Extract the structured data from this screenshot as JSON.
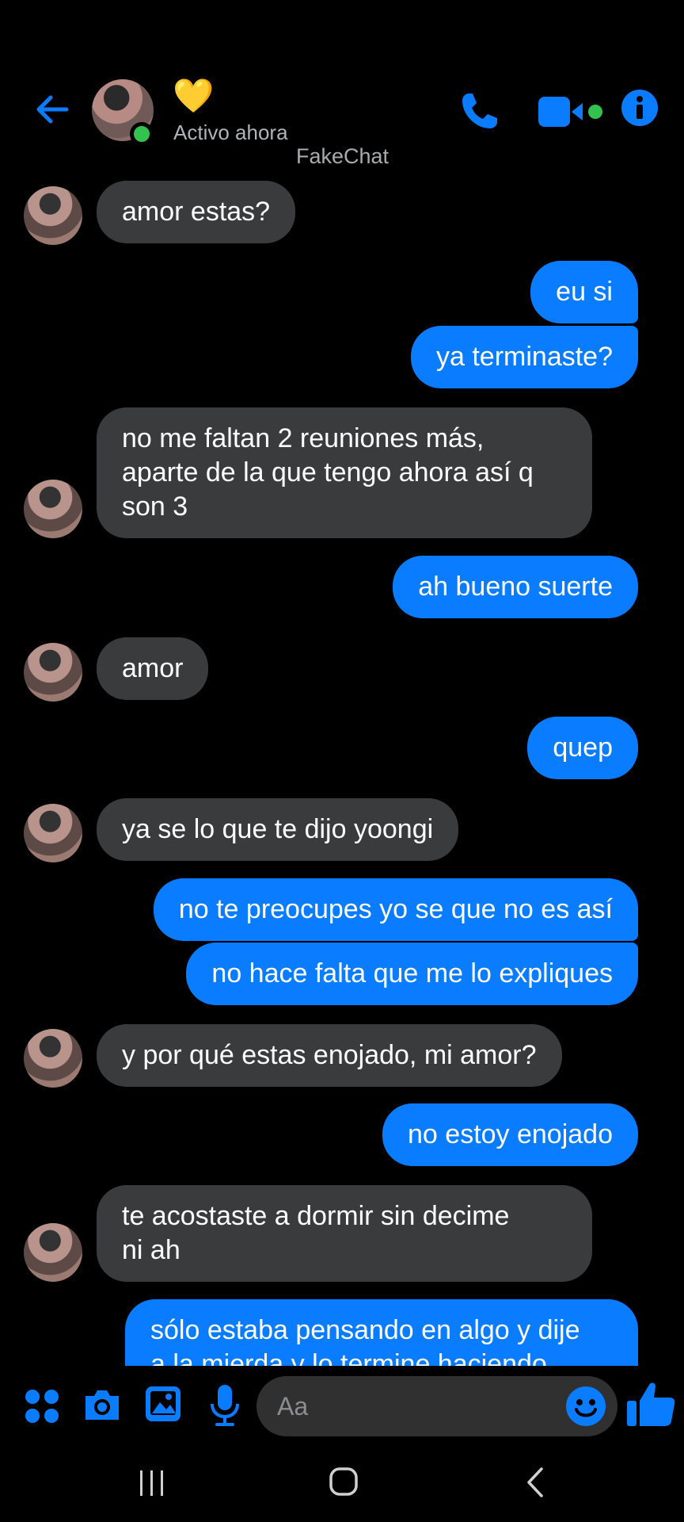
{
  "header": {
    "status_emoji": "💛",
    "status": "Activo ahora",
    "watermark": "FakeChat"
  },
  "messages": [
    {
      "side": "in",
      "text": "amor estas?"
    },
    {
      "side": "out",
      "text": "eu si"
    },
    {
      "side": "out",
      "text": "ya terminaste?"
    },
    {
      "side": "in",
      "text": "no me faltan 2 reuniones más,"
    },
    {
      "side": "in",
      "text": "aparte de la que tengo ahora así q"
    },
    {
      "side": "in",
      "text": "son 3"
    },
    {
      "side": "out",
      "text": "ah bueno suerte"
    },
    {
      "side": "in",
      "text": "amor"
    },
    {
      "side": "out",
      "text": "quep"
    },
    {
      "side": "in",
      "text": "ya se lo que te dijo yoongi"
    },
    {
      "side": "out",
      "text": "no te preocupes yo se que no es así"
    },
    {
      "side": "out",
      "text": "no hace falta que me lo expliques"
    },
    {
      "side": "in",
      "text": "y por qué estas enojado, mi amor?"
    },
    {
      "side": "out",
      "text": "no estoy enojado"
    },
    {
      "side": "in",
      "text": "te acostaste a dormir sin decime"
    },
    {
      "side": "in",
      "text": "ni ah"
    },
    {
      "side": "out",
      "text": "sólo estaba pensando en algo y dije"
    },
    {
      "side": "out",
      "text": "a la mierda y lo termine haciendo"
    }
  ],
  "composer": {
    "placeholder": "Aa"
  },
  "colors": {
    "accent": "#0a7cff",
    "incoming_bubble": "#3a3b3c",
    "online": "#33c24d",
    "background": "#000000"
  },
  "icons": [
    "back-arrow-icon",
    "phone-icon",
    "video-camera-icon",
    "info-icon",
    "apps-grid-icon",
    "camera-icon",
    "gallery-icon",
    "microphone-icon",
    "emoji-icon",
    "thumbs-up-icon"
  ]
}
